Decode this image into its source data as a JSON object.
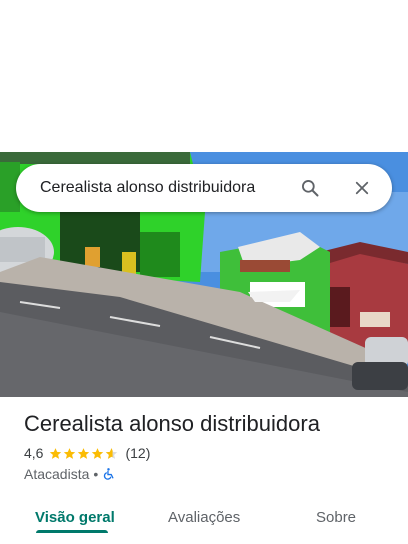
{
  "search": {
    "query": "Cerealista alonso distribuidora"
  },
  "place": {
    "name": "Cerealista alonso distribuidora",
    "rating": "4,6",
    "rating_value": 4.6,
    "reviews_count": "(12)",
    "category": "Atacadista",
    "separator": "•",
    "accessibility_icon": "wheelchair-icon"
  },
  "tabs": [
    {
      "label": "Visão geral",
      "active": true
    },
    {
      "label": "Avaliações",
      "active": false
    },
    {
      "label": "Sobre",
      "active": false
    }
  ],
  "colors": {
    "accent": "#00796b",
    "star": "#fbbc04",
    "accessibility": "#1a73e8"
  }
}
